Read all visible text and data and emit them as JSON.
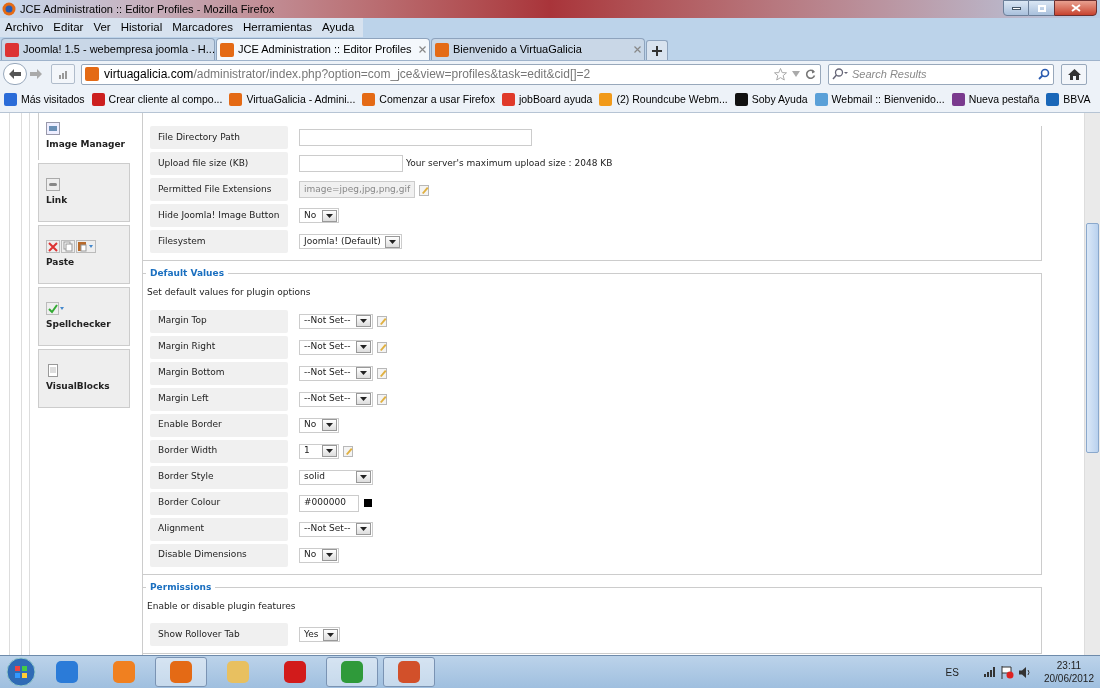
{
  "window": {
    "title": "JCE Administration :: Editor Profiles - Mozilla Firefox"
  },
  "menu": [
    "Archivo",
    "Editar",
    "Ver",
    "Historial",
    "Marcadores",
    "Herramientas",
    "Ayuda"
  ],
  "tabs": [
    {
      "label": "Joomla! 1.5 - webempresa joomla - H...",
      "selected": false
    },
    {
      "label": "JCE Administration :: Editor Profiles",
      "selected": true
    },
    {
      "label": "Bienvenido a VirtuaGalicia",
      "selected": false
    }
  ],
  "url": {
    "host": "virtuagalicia.com",
    "path": "/administrator/index.php?option=com_jce&view=profiles&task=edit&cid[]=2"
  },
  "search": {
    "placeholder": "Search Results"
  },
  "bookmarks": [
    "Más visitados",
    "Crear cliente al compo...",
    "VirtuaGalicia - Admini...",
    "Comenzar a usar Firefox",
    "jobBoard ayuda",
    "(2) Roundcube Webm...",
    "Soby Ayuda",
    "Webmail :: Bienvenido...",
    "Nueva pestaña",
    "BBVA"
  ],
  "sidebar": [
    {
      "label": "Image Manager",
      "selected": true
    },
    {
      "label": "Link",
      "selected": false
    },
    {
      "label": "Paste",
      "selected": false
    },
    {
      "label": "Spellchecker",
      "selected": false
    },
    {
      "label": "VisualBlocks",
      "selected": false
    }
  ],
  "sections": [
    {
      "rows": [
        {
          "label": "File Directory Path",
          "kind": "text",
          "disabled": false,
          "edit_icon": false
        },
        {
          "label": "Upload file size (KB)",
          "kind": "text",
          "disabled": false,
          "edit_icon": false,
          "note": "Your server's maximum upload size : 2048 KB"
        },
        {
          "label": "Permitted File Extensions",
          "kind": "text",
          "value": "image=jpeg,jpg,png,gif",
          "disabled": true,
          "edit_icon": true
        },
        {
          "label": "Hide Joomla! Image Button",
          "kind": "select",
          "value": "No",
          "disabled": false,
          "edit_icon": false
        },
        {
          "label": "Filesystem",
          "kind": "select",
          "value": "Joomla! (Default)",
          "disabled": false,
          "edit_icon": false
        }
      ]
    },
    {
      "title": "Default Values",
      "description": "Set default values for plugin options",
      "rows": [
        {
          "label": "Margin Top",
          "kind": "select",
          "value": "--Not Set--",
          "disabled": false,
          "edit_icon": true
        },
        {
          "label": "Margin Right",
          "kind": "select",
          "value": "--Not Set--",
          "disabled": false,
          "edit_icon": true
        },
        {
          "label": "Margin Bottom",
          "kind": "select",
          "value": "--Not Set--",
          "disabled": false,
          "edit_icon": true
        },
        {
          "label": "Margin Left",
          "kind": "select",
          "value": "--Not Set--",
          "disabled": false,
          "edit_icon": true
        },
        {
          "label": "Enable Border",
          "kind": "select",
          "value": "No",
          "disabled": false,
          "edit_icon": false
        },
        {
          "label": "Border Width",
          "kind": "select",
          "value": "1",
          "disabled": false,
          "edit_icon": true
        },
        {
          "label": "Border Style",
          "kind": "select",
          "value": "solid",
          "disabled": false,
          "edit_icon": false
        },
        {
          "label": "Border Colour",
          "kind": "color",
          "value": "#000000",
          "color": "#000000",
          "disabled": false,
          "edit_icon": false
        },
        {
          "label": "Alignment",
          "kind": "select",
          "value": "--Not Set--",
          "disabled": false,
          "edit_icon": false
        },
        {
          "label": "Disable Dimensions",
          "kind": "select",
          "value": "No",
          "disabled": false,
          "edit_icon": false
        }
      ]
    },
    {
      "title": "Permissions",
      "description": "Enable or disable plugin features",
      "rows": [
        {
          "label": "Show Rollover Tab",
          "kind": "select",
          "value": "Yes",
          "disabled": false,
          "edit_icon": false
        }
      ]
    }
  ],
  "taskbar": {
    "language": "ES",
    "time": "23:11",
    "date": "20/06/2012"
  }
}
